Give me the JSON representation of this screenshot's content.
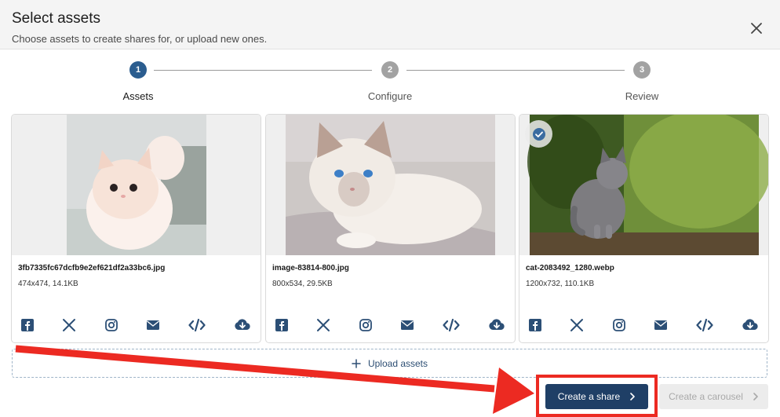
{
  "dialog": {
    "title": "Select assets",
    "subtitle": "Choose assets to create shares for, or upload new ones."
  },
  "stepper": {
    "steps": [
      {
        "number": "1",
        "label": "Assets",
        "active": true
      },
      {
        "number": "2",
        "label": "Configure",
        "active": false
      },
      {
        "number": "3",
        "label": "Review",
        "active": false
      }
    ]
  },
  "assets": [
    {
      "filename": "3fb7335fc67dcfb9e2ef621df2a33bc6.jpg",
      "meta": "474x474, 14.1KB",
      "selected": false
    },
    {
      "filename": "image-83814-800.jpg",
      "meta": "800x534, 29.5KB",
      "selected": false
    },
    {
      "filename": "cat-2083492_1280.webp",
      "meta": "1200x732, 110.1KB",
      "selected": true
    }
  ],
  "share_icons": [
    "facebook-icon",
    "x-icon",
    "instagram-icon",
    "email-icon",
    "embed-code-icon",
    "download-icon"
  ],
  "upload": {
    "label": "Upload assets"
  },
  "actions": {
    "create_share": "Create a share",
    "create_carousel": "Create a carousel"
  },
  "colors": {
    "primary": "#1f3f66",
    "step_active": "#2b5d8f",
    "step_inactive": "#a2a2a2",
    "icon": "#2c4f76",
    "annotation": "#ec2a22",
    "disabled_bg": "#ececec"
  }
}
